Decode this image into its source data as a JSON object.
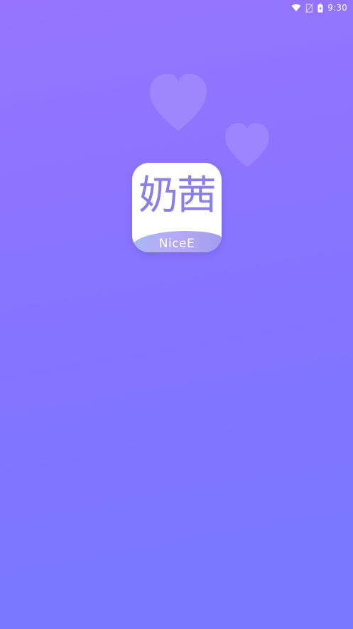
{
  "status_bar": {
    "time": "9:30",
    "icons": [
      "wifi-icon",
      "no-sim-icon",
      "battery-charging-icon"
    ]
  },
  "logo": {
    "glyphs": "奶茜",
    "brand_name": "NiceE"
  },
  "colors": {
    "background_top": "#9674ff",
    "background_bottom": "#7877ff",
    "logo_glyph": "#8a7ee8",
    "logo_band": "#b0aff4"
  }
}
